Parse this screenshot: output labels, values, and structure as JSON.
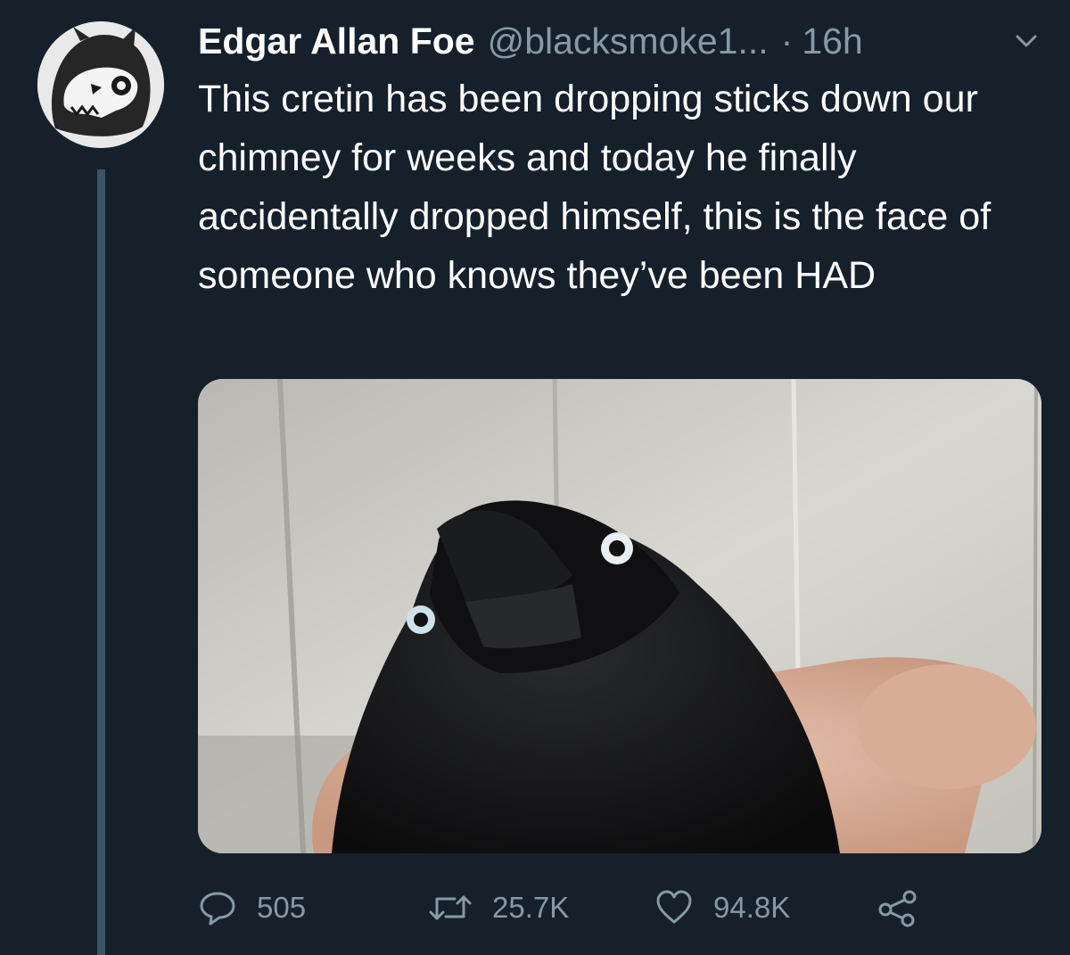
{
  "tweet": {
    "display_name": "Edgar Allan Foe",
    "handle": "@blacksmoke1...",
    "separator": "·",
    "time": "16h",
    "text": "This cretin has been dropping sticks down our chimney for weeks and today he finally accidentally dropped himself, this is the face of someone who knows they’ve been HAD"
  },
  "actions": {
    "reply_count": "505",
    "retweet_count": "25.7K",
    "like_count": "94.8K"
  },
  "icons": {
    "avatar": "wolf-skull-avatar",
    "caret": "chevron-down-icon",
    "reply": "reply-icon",
    "retweet": "retweet-icon",
    "like": "heart-icon",
    "share": "share-icon"
  },
  "colors": {
    "background": "#15202b",
    "text": "#ffffff",
    "secondary_text": "#8899a6",
    "thread_line": "#3d5466"
  }
}
